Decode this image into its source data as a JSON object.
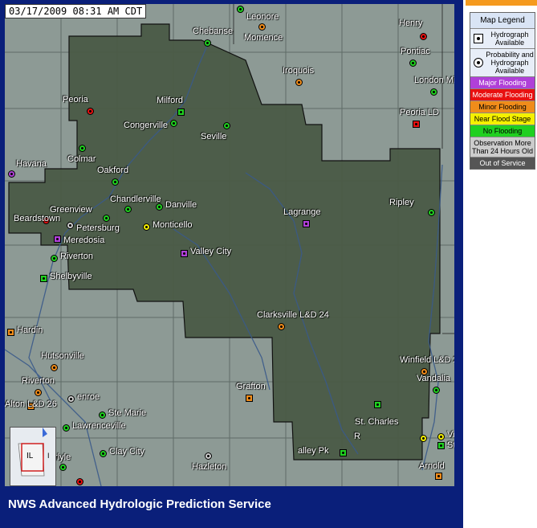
{
  "timestamp": "03/17/2009 08:31 AM CDT",
  "footer_title": "NWS Advanced Hydrologic Prediction Service",
  "colors": {
    "major": "#b040d8",
    "moderate": "#e81010",
    "minor": "#f08c1a",
    "near": "#f5f000",
    "none": "#20d020",
    "old": "#cccccc",
    "out": "#555555"
  },
  "legend": {
    "title": "Map Legend",
    "hydrograph": "Hydrograph Available",
    "probability": "Probability and Hydrograph Available",
    "major": "Major Flooding",
    "moderate": "Moderate Flooding",
    "minor": "Minor Flooding",
    "near": "Near Flood Stage",
    "none": "No Flooding",
    "old": "Observation More Than 24 Hours Old",
    "out": "Out of Service"
  },
  "minimap": {
    "state": "IL",
    "state_right": "I"
  },
  "sites": [
    {
      "name": "Leonore",
      "status": "none",
      "shape": "circle"
    },
    {
      "name": "Momence",
      "status": "minor",
      "shape": "circle"
    },
    {
      "name": "Henry",
      "status": "moderate",
      "shape": "circle"
    },
    {
      "name": "Chebanse",
      "status": "none",
      "shape": "circle"
    },
    {
      "name": "Pontiac",
      "status": "none",
      "shape": "circle"
    },
    {
      "name": "Iroquois",
      "status": "minor",
      "shape": "circle"
    },
    {
      "name": "London Mills",
      "status": "none",
      "shape": "circle"
    },
    {
      "name": "Peoria",
      "status": "moderate",
      "shape": "circle"
    },
    {
      "name": "Milford",
      "status": "none",
      "shape": "square"
    },
    {
      "name": "Peoria LD",
      "status": "moderate",
      "shape": "square"
    },
    {
      "name": "Congerville",
      "status": "none",
      "shape": "circle"
    },
    {
      "name": "Seville",
      "status": "none",
      "shape": "circle"
    },
    {
      "name": "Colmar",
      "status": "none",
      "shape": "circle"
    },
    {
      "name": "Havana",
      "status": "major",
      "shape": "circle"
    },
    {
      "name": "Oakford",
      "status": "none",
      "shape": "circle"
    },
    {
      "name": "Chandlerville",
      "status": "none",
      "shape": "circle"
    },
    {
      "name": "Greenview",
      "status": "none",
      "shape": "circle"
    },
    {
      "name": "Danville",
      "status": "none",
      "shape": "circle"
    },
    {
      "name": "Ripley",
      "status": "none",
      "shape": "circle"
    },
    {
      "name": "Beardstown",
      "status": "moderate",
      "shape": "circle"
    },
    {
      "name": "Petersburg",
      "status": "old",
      "shape": "circle"
    },
    {
      "name": "Monticello",
      "status": "near",
      "shape": "circle"
    },
    {
      "name": "Lagrange",
      "status": "major",
      "shape": "square"
    },
    {
      "name": "Meredosia",
      "status": "major",
      "shape": "square"
    },
    {
      "name": "Riverton",
      "status": "none",
      "shape": "circle"
    },
    {
      "name": "Valley City",
      "status": "major",
      "shape": "square"
    },
    {
      "name": "Shelbyville",
      "status": "none",
      "shape": "square"
    },
    {
      "name": "Clarksville L&D 24",
      "status": "minor",
      "shape": "circle"
    },
    {
      "name": "Hardin",
      "status": "minor",
      "shape": "square"
    },
    {
      "name": "Hutsonville",
      "status": "minor",
      "shape": "circle"
    },
    {
      "name": "Winfield L&D 25",
      "status": "minor",
      "shape": "circle"
    },
    {
      "name": "Riverton",
      "status": "minor",
      "shape": "circle"
    },
    {
      "name": "Vandalia",
      "status": "none",
      "shape": "circle"
    },
    {
      "name": "Grafton",
      "status": "minor",
      "shape": "square"
    },
    {
      "name": "enroe",
      "status": "old",
      "shape": "circle"
    },
    {
      "name": "Alton L&D 26",
      "status": "minor",
      "shape": "square"
    },
    {
      "name": "Ste Marie",
      "status": "none",
      "shape": "circle"
    },
    {
      "name": "St. Charles",
      "status": "none",
      "shape": "square"
    },
    {
      "name": "Lawrenceville",
      "status": "none",
      "shape": "circle"
    },
    {
      "name": "R",
      "status": "near",
      "shape": "circle"
    },
    {
      "name": "Vi",
      "status": "near",
      "shape": "circle"
    },
    {
      "name": "St. Louis",
      "status": "none",
      "shape": "square"
    },
    {
      "name": "Clay City",
      "status": "none",
      "shape": "circle"
    },
    {
      "name": "alley Pk",
      "status": "none",
      "shape": "square"
    },
    {
      "name": "Carlyle",
      "status": "none",
      "shape": "circle"
    },
    {
      "name": "Hazleton",
      "status": "old",
      "shape": "circle"
    },
    {
      "name": "Arnold",
      "status": "minor",
      "shape": "square"
    },
    {
      "name": "(top)",
      "status": "moderate",
      "shape": "circle"
    },
    {
      "name": "(left)",
      "status": "none",
      "shape": "circle"
    }
  ]
}
